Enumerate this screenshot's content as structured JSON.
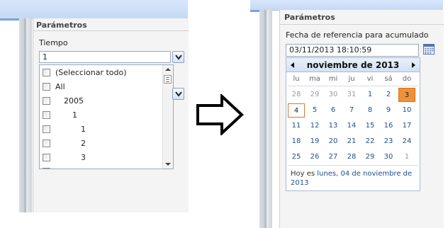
{
  "left_panel": {
    "header": "Parámetros",
    "field_label": "Tiempo",
    "input_value": "1",
    "list_items": [
      {
        "label": "(Seleccionar todo)",
        "indent": 0
      },
      {
        "label": "All",
        "indent": 0
      },
      {
        "label": "2005",
        "indent": 1
      },
      {
        "label": "1",
        "indent": 2
      },
      {
        "label": "1",
        "indent": 3
      },
      {
        "label": "2",
        "indent": 3
      },
      {
        "label": "3",
        "indent": 3
      }
    ]
  },
  "right_panel": {
    "header": "Parámetros",
    "field_label": "Fecha de referencia para acumulado",
    "input_value": "03/11/2013 18:10:59",
    "calendar": {
      "month_title": "noviembre de 2013",
      "weekdays": [
        "lu",
        "ma",
        "mi",
        "ju",
        "vi",
        "sá",
        "do"
      ],
      "weeks": [
        [
          "28",
          "29",
          "30",
          "31",
          "1",
          "2",
          "3"
        ],
        [
          "4",
          "5",
          "6",
          "7",
          "8",
          "9",
          "10"
        ],
        [
          "11",
          "12",
          "13",
          "14",
          "15",
          "16",
          "17"
        ],
        [
          "18",
          "19",
          "20",
          "21",
          "22",
          "23",
          "24"
        ],
        [
          "25",
          "26",
          "27",
          "28",
          "29",
          "30",
          "1"
        ]
      ],
      "selected_day": "3",
      "today_day": "4",
      "footer_prefix": "Hoy es ",
      "footer_link": "lunes, 04 de noviembre de 2013"
    }
  },
  "colors": {
    "selected": "#f0913a",
    "link": "#1f4e8c",
    "header_bar": "#c5d9f4"
  }
}
